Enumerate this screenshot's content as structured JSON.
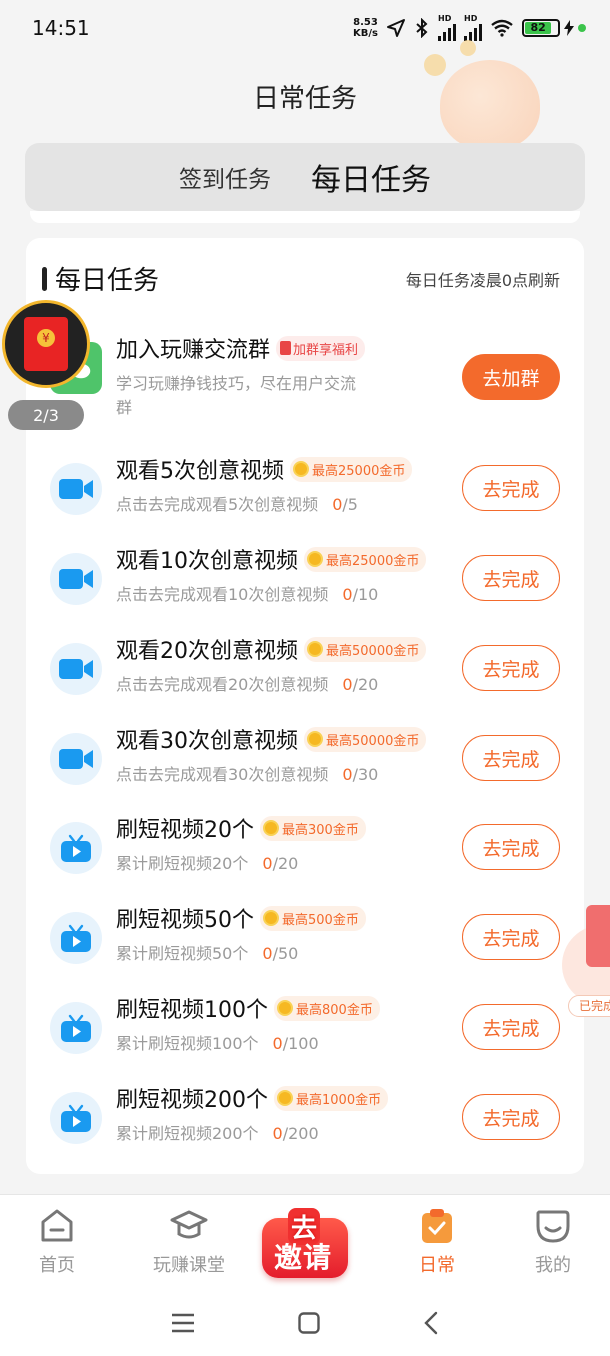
{
  "status_bar": {
    "time": "14:51",
    "net_speed_value": "8.53",
    "net_speed_unit": "KB/s",
    "hd1": "HD",
    "hd2": "HD",
    "battery": "82"
  },
  "header": {
    "title": "日常任务"
  },
  "tabs": [
    {
      "label": "签到任务",
      "active": false
    },
    {
      "label": "每日任务",
      "active": true
    }
  ],
  "card": {
    "title": "每日任务",
    "refresh_note": "每日任务凌晨0点刷新"
  },
  "join_group": {
    "title": "加入玩赚交流群",
    "tag": "加群享福利",
    "desc_line1": "学习玩赚挣钱技巧，尽在用户交流",
    "desc_line2": "群",
    "button": "去加群"
  },
  "tasks": [
    {
      "title": "观看5次创意视频",
      "reward": "最高25000金币",
      "desc": "点击去完成观看5次创意视频",
      "done": "0",
      "total": "/5",
      "button": "去完成",
      "icon": "video-camera-icon"
    },
    {
      "title": "观看10次创意视频",
      "reward": "最高25000金币",
      "desc": "点击去完成观看10次创意视频",
      "done": "0",
      "total": "/10",
      "button": "去完成",
      "icon": "video-camera-icon"
    },
    {
      "title": "观看20次创意视频",
      "reward": "最高50000金币",
      "desc": "点击去完成观看20次创意视频",
      "done": "0",
      "total": "/20",
      "button": "去完成",
      "icon": "video-camera-icon"
    },
    {
      "title": "观看30次创意视频",
      "reward": "最高50000金币",
      "desc": "点击去完成观看30次创意视频",
      "done": "0",
      "total": "/30",
      "button": "去完成",
      "icon": "video-camera-icon"
    },
    {
      "title": "刷短视频20个",
      "reward": "最高300金币",
      "desc": "累计刷短视频20个",
      "done": "0",
      "total": "/20",
      "button": "去完成",
      "icon": "tv-play-icon"
    },
    {
      "title": "刷短视频50个",
      "reward": "最高500金币",
      "desc": "累计刷短视频50个",
      "done": "0",
      "total": "/50",
      "button": "去完成",
      "icon": "tv-play-icon"
    },
    {
      "title": "刷短视频100个",
      "reward": "最高800金币",
      "desc": "累计刷短视频100个",
      "done": "0",
      "total": "/100",
      "button": "去完成",
      "icon": "tv-play-icon"
    },
    {
      "title": "刷短视频200个",
      "reward": "最高1000金币",
      "desc": "累计刷短视频200个",
      "done": "0",
      "total": "/200",
      "button": "去完成",
      "icon": "tv-play-icon"
    }
  ],
  "float_widget": {
    "count": "2/3"
  },
  "side_bubble": {
    "label": "已完成"
  },
  "bottom_nav": {
    "home": "首页",
    "class": "玩赚课堂",
    "invite_top": "去",
    "invite_bottom": "邀请",
    "daily": "日常",
    "me": "我的"
  },
  "colors": {
    "accent": "#f36a2c",
    "icon_blue": "#1a9af0"
  }
}
